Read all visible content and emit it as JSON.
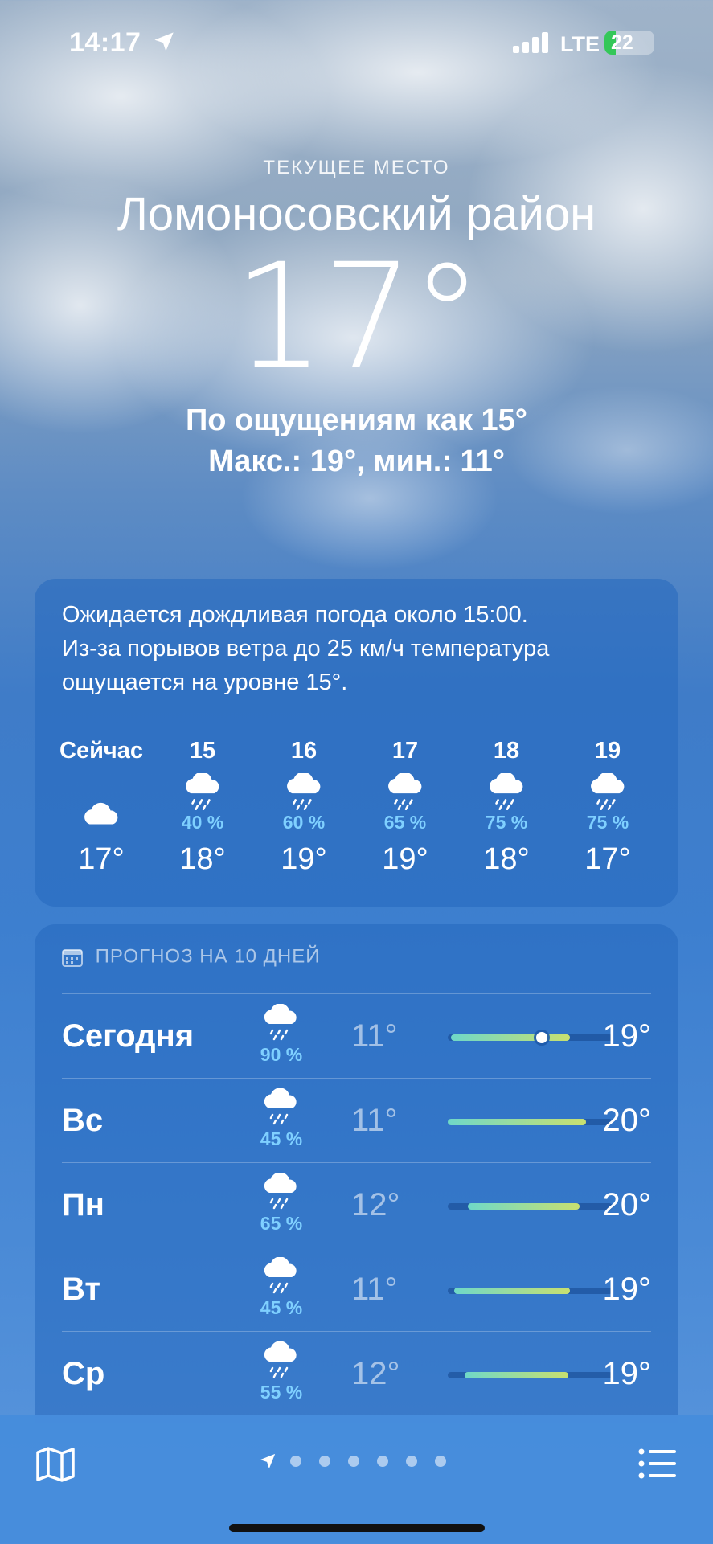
{
  "status_bar": {
    "time": "14:17",
    "network": "LTE",
    "battery": "22"
  },
  "header": {
    "current_location_label": "ТЕКУЩЕЕ МЕСТО",
    "city": "Ломоносовский район",
    "temperature": "17°",
    "feels_like": "По ощущениям как 15°",
    "min_max": "Макс.: 19°, мин.: 11°"
  },
  "hourly": {
    "summary_line1": "Ожидается дождливая погода около 15:00.",
    "summary_line2": "Из-за порывов ветра до 25 км/ч температура",
    "summary_line3": "ощущается на уровне 15°.",
    "hours": [
      {
        "label": "Сейчас",
        "icon": "cloud-icon",
        "pct": "",
        "temp": "17°"
      },
      {
        "label": "15",
        "icon": "cloud-rain-icon",
        "pct": "40 %",
        "temp": "18°"
      },
      {
        "label": "16",
        "icon": "cloud-rain-icon",
        "pct": "60 %",
        "temp": "19°"
      },
      {
        "label": "17",
        "icon": "cloud-rain-icon",
        "pct": "65 %",
        "temp": "19°"
      },
      {
        "label": "18",
        "icon": "cloud-rain-icon",
        "pct": "75 %",
        "temp": "18°"
      },
      {
        "label": "19",
        "icon": "cloud-rain-icon",
        "pct": "75 %",
        "temp": "17°"
      }
    ]
  },
  "ten_day": {
    "title": "ПРОГНОЗ НА 10 ДНЕЙ",
    "days": [
      {
        "day": "Сегодня",
        "icon": "cloud-rain-icon",
        "pct": "90 %",
        "low": "11°",
        "high": "19°",
        "range_start": 0.02,
        "range_end": 0.74,
        "current": 0.57
      },
      {
        "day": "Вс",
        "icon": "cloud-rain-icon",
        "pct": "45 %",
        "low": "11°",
        "high": "20°",
        "range_start": 0.0,
        "range_end": 0.84
      },
      {
        "day": "Пн",
        "icon": "cloud-rain-icon",
        "pct": "65 %",
        "low": "12°",
        "high": "20°",
        "range_start": 0.12,
        "range_end": 0.8
      },
      {
        "day": "Вт",
        "icon": "cloud-rain-icon",
        "pct": "45 %",
        "low": "11°",
        "high": "19°",
        "range_start": 0.04,
        "range_end": 0.74
      },
      {
        "day": "Ср",
        "icon": "cloud-rain-icon",
        "pct": "55 %",
        "low": "12°",
        "high": "19°",
        "range_start": 0.1,
        "range_end": 0.73
      }
    ]
  },
  "bottom_bar": {
    "page_count": 6,
    "map_icon": "map-icon",
    "list_icon": "list-icon"
  }
}
